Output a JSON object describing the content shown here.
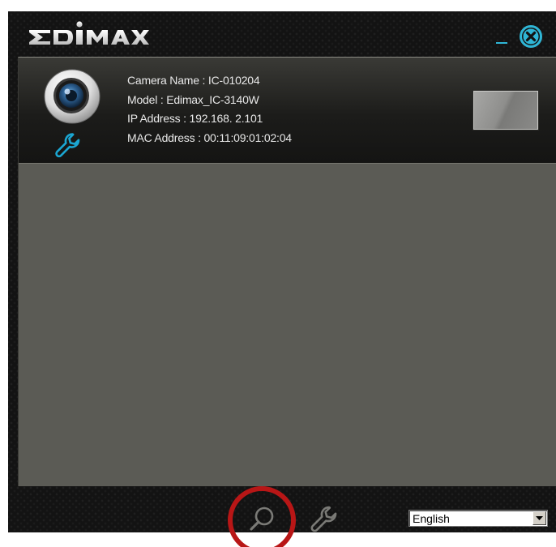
{
  "app": {
    "brand": "EDIMAX",
    "accent_color": "#2fb6d6",
    "window_background": "#131313"
  },
  "title_bar": {
    "minimize_icon": "minimize-icon",
    "close_icon": "close-circle-x-icon"
  },
  "camera_list": {
    "background": "#5b5b55",
    "cameras": [
      {
        "icon": "webcam-icon",
        "settings_icon": "wrench-icon",
        "name_line": "Camera Name : IC-010204",
        "model_line": "Model : Edimax_IC-3140W",
        "ip_line": "IP Address : 192.168.  2.101",
        "mac_line": "MAC Address : 00:11:09:01:02:04",
        "preview": "camera-preview-thumbnail"
      }
    ]
  },
  "toolbar": {
    "search_icon": "search-icon",
    "settings_icon": "wrench-icon",
    "language": {
      "selected": "English",
      "dropdown_icon": "chevron-down-icon"
    }
  },
  "annotation": {
    "highlight_color": "#b81616",
    "highlighted_control": "search-button"
  }
}
